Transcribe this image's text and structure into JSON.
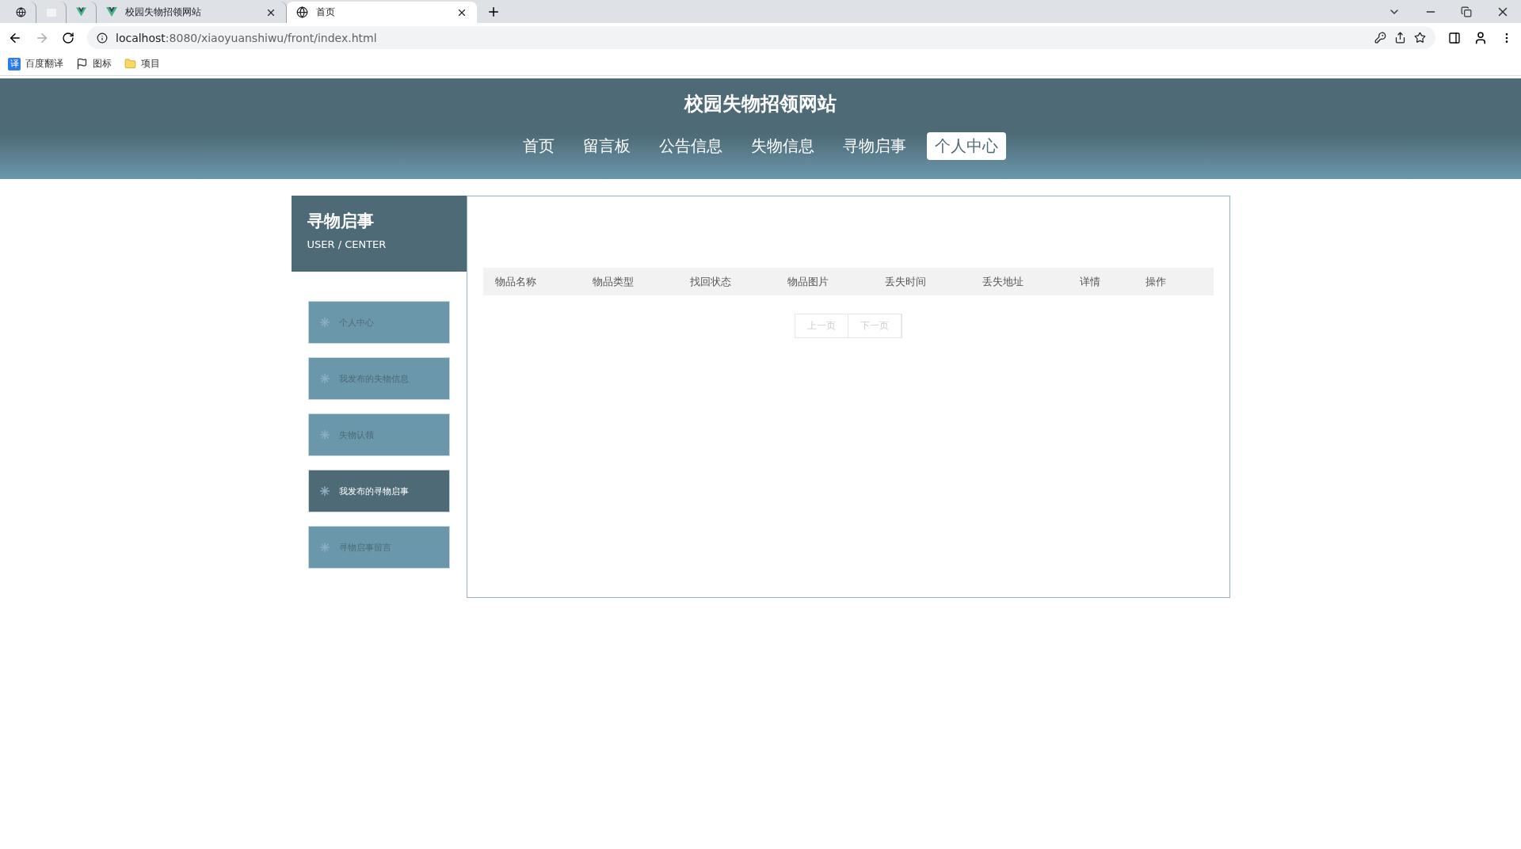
{
  "browser": {
    "tabs": [
      {
        "kind": "globe",
        "selected": false
      },
      {
        "kind": "blank",
        "selected": false
      },
      {
        "kind": "vue",
        "selected": false
      },
      {
        "kind": "vue",
        "title": "校园失物招领网站",
        "selected": false
      },
      {
        "kind": "globe",
        "title": "首页",
        "selected": true
      }
    ],
    "address": {
      "host": "localhost",
      "rest": ":8080/xiaoyuanshiwu/front/index.html"
    },
    "bookmarks": [
      {
        "kind": "translate",
        "glyph": "译",
        "label": "百度翻译"
      },
      {
        "kind": "flag",
        "label": "图标"
      },
      {
        "kind": "folder",
        "label": "项目"
      }
    ]
  },
  "site": {
    "title": "校园失物招领网站",
    "nav": [
      {
        "label": "首页",
        "selected": false
      },
      {
        "label": "留言板",
        "selected": false
      },
      {
        "label": "公告信息",
        "selected": false
      },
      {
        "label": "失物信息",
        "selected": false
      },
      {
        "label": "寻物启事",
        "selected": false
      },
      {
        "label": "个人中心",
        "selected": true
      }
    ]
  },
  "sidebar": {
    "title": "寻物启事",
    "subtitle": "USER / CENTER",
    "items": [
      {
        "label": "个人中心",
        "selected": false
      },
      {
        "label": "我发布的失物信息",
        "selected": false
      },
      {
        "label": "失物认领",
        "selected": false
      },
      {
        "label": "我发布的寻物启事",
        "selected": true
      },
      {
        "label": "寻物启事留言",
        "selected": false
      }
    ]
  },
  "table": {
    "columns": [
      "物品名称",
      "物品类型",
      "找回状态",
      "物品图片",
      "丢失时间",
      "丢失地址",
      "详情",
      "操作"
    ]
  },
  "pagination": {
    "prev": "上一页",
    "next": "下一页"
  }
}
